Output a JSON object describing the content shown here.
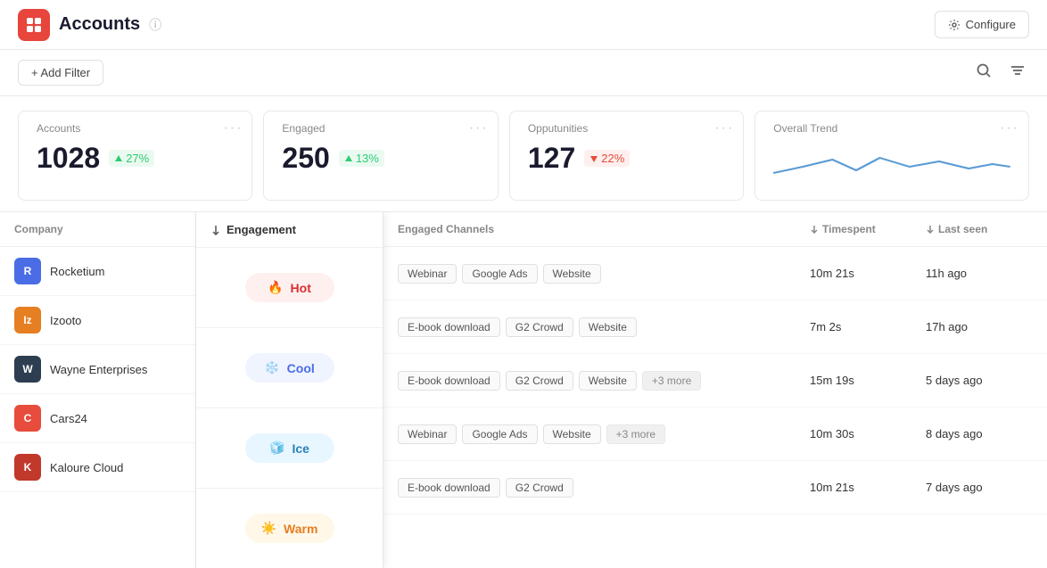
{
  "header": {
    "title": "Accounts",
    "info_icon": "ⓘ",
    "configure_label": "Configure"
  },
  "toolbar": {
    "add_filter_label": "+ Add Filter"
  },
  "stats": [
    {
      "id": "accounts",
      "label": "Accounts",
      "value": "1028",
      "badge": "27%",
      "badge_type": "up"
    },
    {
      "id": "engaged",
      "label": "Engaged",
      "value": "250",
      "badge": "13%",
      "badge_type": "up"
    },
    {
      "id": "opportunities",
      "label": "Opputunities",
      "value": "127",
      "badge": "22%",
      "badge_type": "down"
    }
  ],
  "trend": {
    "label": "Overall Trend"
  },
  "company_col_header": "Company",
  "companies": [
    {
      "id": "rocketium",
      "name": "Rocketium",
      "color": "#4a6de5",
      "initials": "R"
    },
    {
      "id": "izooto",
      "name": "Izooto",
      "color": "#e67e22",
      "initials": "Iz"
    },
    {
      "id": "wayne",
      "name": "Wayne Enterprises",
      "color": "#2c3e50",
      "initials": "W"
    },
    {
      "id": "cars24",
      "name": "Cars24",
      "color": "#e74c3c",
      "initials": "C"
    },
    {
      "id": "kaloure",
      "name": "Kaloure Cloud",
      "color": "#c0392b",
      "initials": "K"
    }
  ],
  "engagement_header": "Engagement",
  "engagements": [
    {
      "label": "Hot",
      "type": "hot",
      "emoji": "🔥"
    },
    {
      "label": "Cool",
      "type": "cool",
      "emoji": "❄️"
    },
    {
      "label": "Ice",
      "type": "ice",
      "emoji": "🧊"
    },
    {
      "label": "Warm",
      "type": "warm",
      "emoji": "☀️"
    },
    {
      "label": "",
      "type": "",
      "emoji": ""
    }
  ],
  "data_headers": {
    "engaged_channels": "Engaged Channels",
    "timespent": "Timespent",
    "last_seen": "Last seen"
  },
  "data_rows": [
    {
      "tags": [
        "Webinar",
        "Google Ads",
        "Website"
      ],
      "extra_tags": [],
      "timespent": "10m 21s",
      "last_seen": "11h ago"
    },
    {
      "tags": [
        "E-book download",
        "G2 Crowd",
        "Website"
      ],
      "extra_tags": [],
      "timespent": "7m 2s",
      "last_seen": "17h ago"
    },
    {
      "tags": [
        "E-book download",
        "G2 Crowd",
        "Website"
      ],
      "extra_tags": [
        "+3 more"
      ],
      "timespent": "15m 19s",
      "last_seen": "5 days ago"
    },
    {
      "tags": [
        "Webinar",
        "Google Ads",
        "Website"
      ],
      "extra_tags": [
        "+3 more"
      ],
      "timespent": "10m 30s",
      "last_seen": "8 days ago"
    },
    {
      "tags": [
        "E-book download",
        "G2 Crowd"
      ],
      "extra_tags": [],
      "timespent": "10m 21s",
      "last_seen": "7 days ago"
    }
  ]
}
